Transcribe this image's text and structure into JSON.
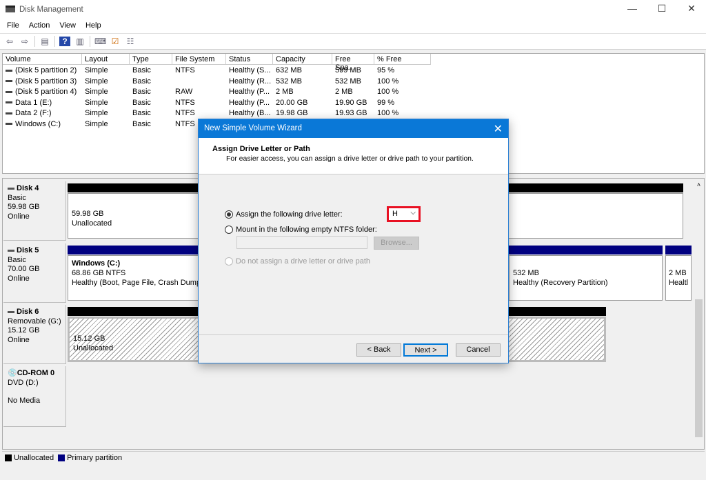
{
  "window": {
    "title": "Disk Management",
    "minimize": "—",
    "maximize": "☐",
    "close": "✕"
  },
  "menu": [
    "File",
    "Action",
    "View",
    "Help"
  ],
  "toolbar": [
    "back-icon",
    "forward-icon",
    "console-tree-icon",
    "help-icon",
    "show-pane-icon",
    "rescan-icon",
    "check-icon",
    "properties-icon"
  ],
  "volumes": {
    "columns": [
      "Volume",
      "Layout",
      "Type",
      "File System",
      "Status",
      "Capacity",
      "Free Spa...",
      "% Free"
    ],
    "rows": [
      [
        "(Disk 5 partition 2)",
        "Simple",
        "Basic",
        "NTFS",
        "Healthy (S...",
        "632 MB",
        "599 MB",
        "95 %"
      ],
      [
        "(Disk 5 partition 3)",
        "Simple",
        "Basic",
        "",
        "Healthy (R...",
        "532 MB",
        "532 MB",
        "100 %"
      ],
      [
        "(Disk 5 partition 4)",
        "Simple",
        "Basic",
        "RAW",
        "Healthy (P...",
        "2 MB",
        "2 MB",
        "100 %"
      ],
      [
        "Data 1 (E:)",
        "Simple",
        "Basic",
        "NTFS",
        "Healthy (P...",
        "20.00 GB",
        "19.90 GB",
        "99 %"
      ],
      [
        "Data 2 (F:)",
        "Simple",
        "Basic",
        "NTFS",
        "Healthy (B...",
        "19.98 GB",
        "19.93 GB",
        "100 %"
      ],
      [
        "Windows (C:)",
        "Simple",
        "Basic",
        "NTFS",
        "",
        "",
        "",
        ""
      ]
    ]
  },
  "disks": [
    {
      "name": "Disk 4",
      "type": "Basic",
      "size": "59.98 GB",
      "status": "Online"
    },
    {
      "name": "Disk 5",
      "type": "Basic",
      "size": "70.00 GB",
      "status": "Online"
    },
    {
      "name": "Disk 6",
      "type": "Removable (G:)",
      "size": "15.12 GB",
      "status": "Online"
    },
    {
      "name": "CD-ROM 0",
      "type": "DVD (D:)",
      "size": "",
      "status": "No Media"
    }
  ],
  "partitions": {
    "disk4": {
      "size": "59.98 GB",
      "label": "Unallocated"
    },
    "disk5_windows": {
      "name": "Windows  (C:)",
      "size": "68.86 GB NTFS",
      "status": "Healthy (Boot, Page File, Crash Dump,"
    },
    "disk5_recovery": {
      "size": "532 MB",
      "status": "Healthy (Recovery Partition)"
    },
    "disk5_small": {
      "size": "2 MB",
      "status": "Healtl"
    },
    "disk6": {
      "size": "15.12 GB",
      "label": "Unallocated"
    }
  },
  "legend": {
    "unallocated": "Unallocated",
    "primary": "Primary partition",
    "colors": {
      "unallocated": "#000000",
      "primary": "#000080"
    }
  },
  "dialog": {
    "title": "New Simple Volume Wizard",
    "heading": "Assign Drive Letter or Path",
    "subheading": "For easier access, you can assign a drive letter or drive path to your partition.",
    "option_letter": "Assign the following drive letter:",
    "drive_letter": "H",
    "option_folder": "Mount in the following empty NTFS folder:",
    "folder_value": "",
    "browse": "Browse...",
    "option_none": "Do not assign a drive letter or drive path",
    "back": "< Back",
    "next": "Next >",
    "cancel": "Cancel",
    "highlight_color": "#e81123"
  }
}
